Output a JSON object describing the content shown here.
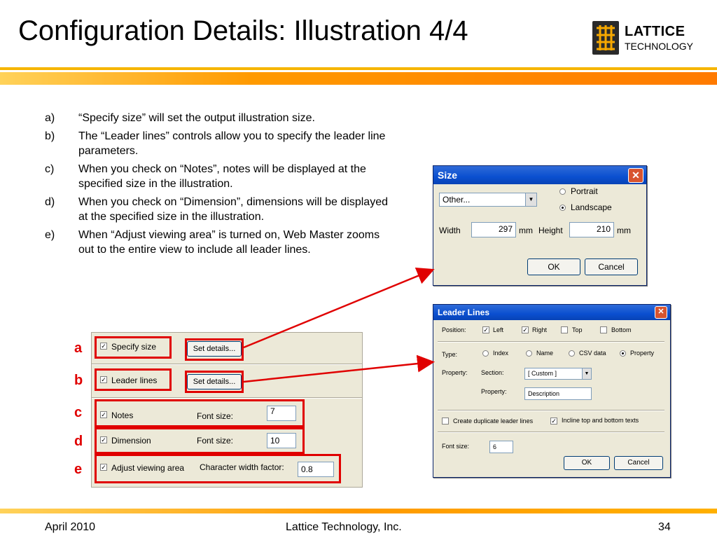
{
  "title": "Configuration Details: Illustration 4/4",
  "logo": {
    "line1": "LATTICE",
    "line2": "TECHNOLOGY"
  },
  "bullets": [
    {
      "letter": "a)",
      "text": "“Specify size” will set the output illustration size."
    },
    {
      "letter": "b)",
      "text": "The “Leader lines” controls allow you to specify the leader line parameters."
    },
    {
      "letter": "c)",
      "text": "When you check on “Notes”, notes will be displayed at the specified size in the illustration."
    },
    {
      "letter": "d)",
      "text": "When you check on “Dimension”, dimensions will be displayed at the specified size in the illustration."
    },
    {
      "letter": "e)",
      "text": "When “Adjust viewing area” is turned on, Web Master zooms out to the entire view to include all leader lines."
    }
  ],
  "options_panel": {
    "specify_size": "Specify size",
    "leader_lines": "Leader lines",
    "set_details": "Set details...",
    "notes": "Notes",
    "dimension": "Dimension",
    "adjust_viewing_area": "Adjust viewing area",
    "font_size_label": "Font size:",
    "notes_font_size": "7",
    "dimension_font_size": "10",
    "char_width_label": "Character width factor:",
    "char_width_value": "0.8"
  },
  "callouts": [
    "a",
    "b",
    "c",
    "d",
    "e"
  ],
  "size_dialog": {
    "title": "Size",
    "close": "✕",
    "preset": "Other...",
    "portrait": "Portrait",
    "landscape": "Landscape",
    "width_label": "Width",
    "width_value": "297",
    "height_label": "Height",
    "height_value": "210",
    "unit": "mm",
    "ok": "OK",
    "cancel": "Cancel"
  },
  "leader_dialog": {
    "title": "Leader Lines",
    "close": "✕",
    "position_label": "Position:",
    "left": "Left",
    "right": "Right",
    "top": "Top",
    "bottom": "Bottom",
    "type_label": "Type:",
    "index": "Index",
    "name": "Name",
    "csv_data": "CSV data",
    "property": "Property",
    "property_label": "Property:",
    "section_label": "Section:",
    "section_value": "[ Custom ]",
    "property_field_label": "Property:",
    "property_value": "Description",
    "create_duplicate": "Create duplicate leader lines",
    "incline": "Incline top and bottom texts",
    "font_size_label": "Font size:",
    "font_size_value": "6",
    "ok": "OK",
    "cancel": "Cancel"
  },
  "footer": {
    "date": "April 2010",
    "company": "Lattice Technology, Inc.",
    "page": "34"
  },
  "colors": {
    "accent_red": "#e00000",
    "band_orange": "#ff9a00",
    "dialog_bg": "#ece9d8"
  }
}
